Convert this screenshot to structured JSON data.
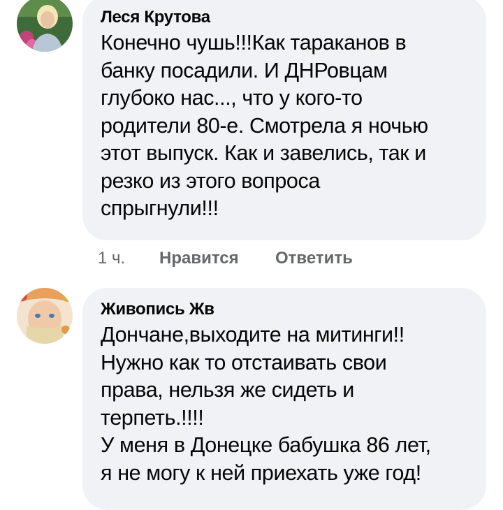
{
  "comments": [
    {
      "author": "Леся Крутова",
      "text": "Конечно чушь!!!Как тараканов в\nбанку посадили. И ДНРовцам\nглубоко нас..., что у кого-то\nродители 80-е. Смотрела я ночью\nэтот выпуск. Как и завелись, так и\nрезко из этого вопроса\nспрыгнули!!!",
      "time": "1 ч.",
      "like_label": "Нравится",
      "reply_label": "Ответить"
    },
    {
      "author": "Живопись Жв",
      "text": "Дончане,выходите на митинги!!\nНужно как то отстаивать свои\nправа, нельзя же сидеть и\nтерпеть.!!!!\nУ меня в Донецке бабушка 86 лет,\nя не могу к ней приехать уже год!"
    }
  ],
  "colors": {
    "bubble_bg": "#f0f2f5",
    "text": "#050505",
    "secondary_text": "#65676b"
  }
}
